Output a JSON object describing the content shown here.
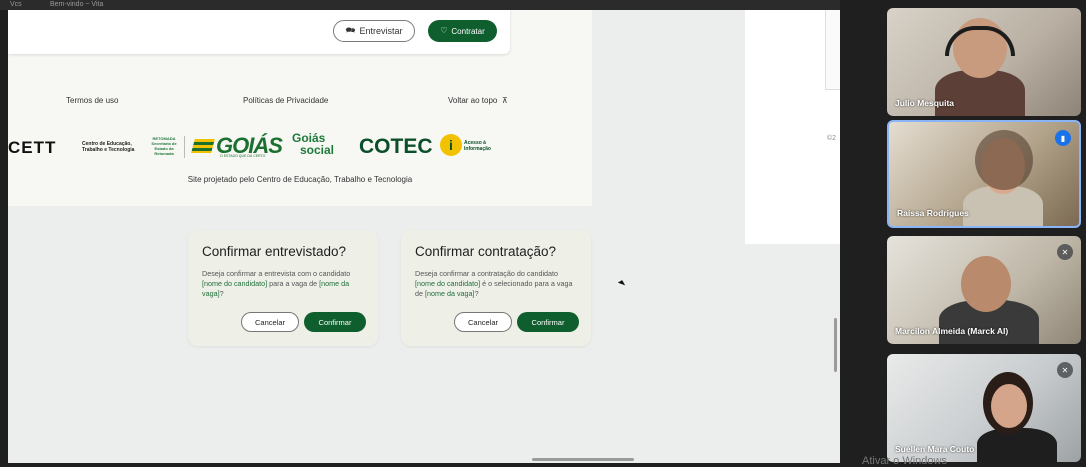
{
  "tabstrip": {
    "left_label": "Vcs",
    "mid_label": "Bem-vindo ~ Vita"
  },
  "site": {
    "interview_button": "Entrevistar",
    "hire_button": "Contratar",
    "footer": {
      "terms": "Termos de uso",
      "privacy": "Políticas de Privacidade",
      "back_to_top": "Voltar ao topo",
      "credit": "Site projetado pelo Centro de Educação, Trabalho e Tecnologia"
    },
    "logos": {
      "cett": "CETT",
      "cett_sub": "Centro de Educação, Trabalho e Tecnologia",
      "retomada": "RETOMADA Secretaria de Estado da Retomada",
      "goias": "GOIÁS",
      "goias_sub": "O ESTADO QUE DÁ CERTO",
      "goias_social_1": "Goiás",
      "goias_social_2": "social",
      "cotec": "COTEC",
      "acesso": "Acesso à Informação"
    },
    "right_copy": "©2"
  },
  "dialogs": [
    {
      "title": "Confirmar entrevistado?",
      "text_1": "Deseja confirmar a entrevista com o candidato ",
      "ph_1": "[nome do candidato]",
      "text_2": " para a vaga de ",
      "ph_2": "[nome da vaga]",
      "text_3": "?",
      "cancel": "Cancelar",
      "confirm": "Confirmar"
    },
    {
      "title": "Confirmar contratação?",
      "text_1": "Deseja confirmar a contratação do candidato ",
      "ph_1": "[nome do candidato]",
      "text_2": " é o selecionado para a vaga de ",
      "ph_2": "[nome da vaga]",
      "text_3": "?",
      "cancel": "Cancelar",
      "confirm": "Confirmar"
    }
  ],
  "participants": [
    {
      "name": "Julio Mesquita",
      "mic": "none"
    },
    {
      "name": "Raíssa Rodrigues",
      "mic": "speaking"
    },
    {
      "name": "Marcilon Almeida (Marck AI)",
      "mic": "muted"
    },
    {
      "name": "Suellen Mara Couto",
      "mic": "muted"
    }
  ],
  "watermark": "Ativar o Windows",
  "colors": {
    "brand_green": "#0f5e2e",
    "active_tile_border": "#8ab4f8",
    "speaking_badge": "#1a73e8"
  },
  "icons": [
    "chat-icon",
    "heart-hand-icon",
    "chevron-up-icon",
    "mic-off-icon",
    "audio-bars-icon",
    "cursor-icon"
  ]
}
